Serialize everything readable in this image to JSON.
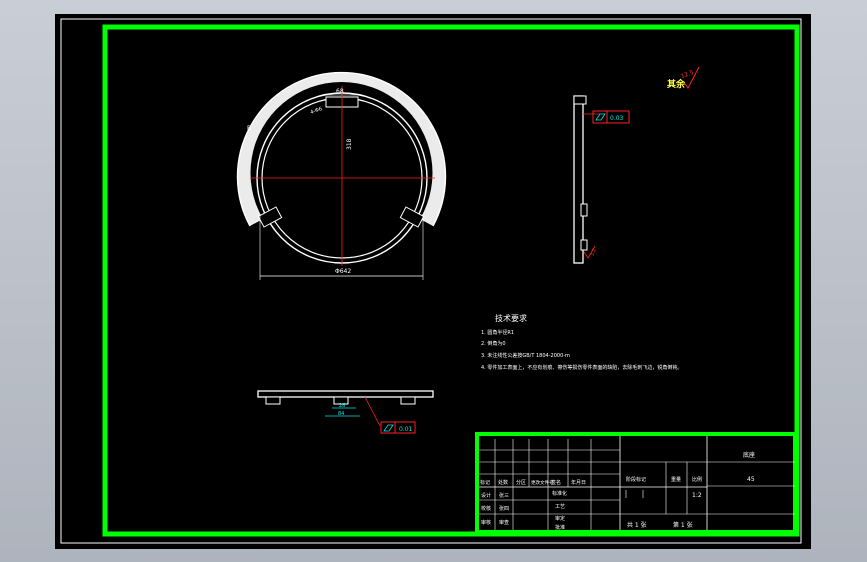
{
  "colors": {
    "frame": "#00ff00",
    "outline": "#ffffff",
    "dimension": "#ff2020",
    "annotation": "#00e5e5",
    "background": "#000000"
  },
  "views": {
    "front": {
      "top_dim": "68",
      "radius_dim": "318",
      "diameter_dim": "Φ642",
      "small_label": "4-Φ6"
    },
    "side": {
      "flatness_value": "0.03",
      "roughness_bottom": "3.2"
    },
    "bottom": {
      "dim_a": "26",
      "dim_b": "84",
      "flatness_value": "0.01"
    },
    "roughness_note": {
      "value": "12.5",
      "text": "其余"
    }
  },
  "tech_requirements": {
    "title": "技术要求",
    "items": [
      "1. 圆角半径R1",
      "2. 倒角为0",
      "3. 未注线性公差按GB/T 1804-2000-m",
      "4. 零件加工表面上，不应有划痕、擦伤等损伤零件表面的缺陷，去除毛刺飞边，锐角倒钝。"
    ]
  },
  "title_block": {
    "part_name": "底座",
    "material": "45",
    "scale": "1:2",
    "row_labels": [
      "标记",
      "处数",
      "分区",
      "更改文件号",
      "签名",
      "年月日"
    ],
    "left_labels": [
      "设计",
      "校核",
      "审核"
    ],
    "left_values": [
      "张三",
      "张四",
      "审查"
    ],
    "mid_labels": [
      "标准化",
      "工艺",
      "审定",
      "批准"
    ],
    "stage_labels": [
      "阶段标记",
      "重量",
      "比例"
    ],
    "sheet_a": "共 1 张",
    "sheet_b": "第 1 张"
  }
}
